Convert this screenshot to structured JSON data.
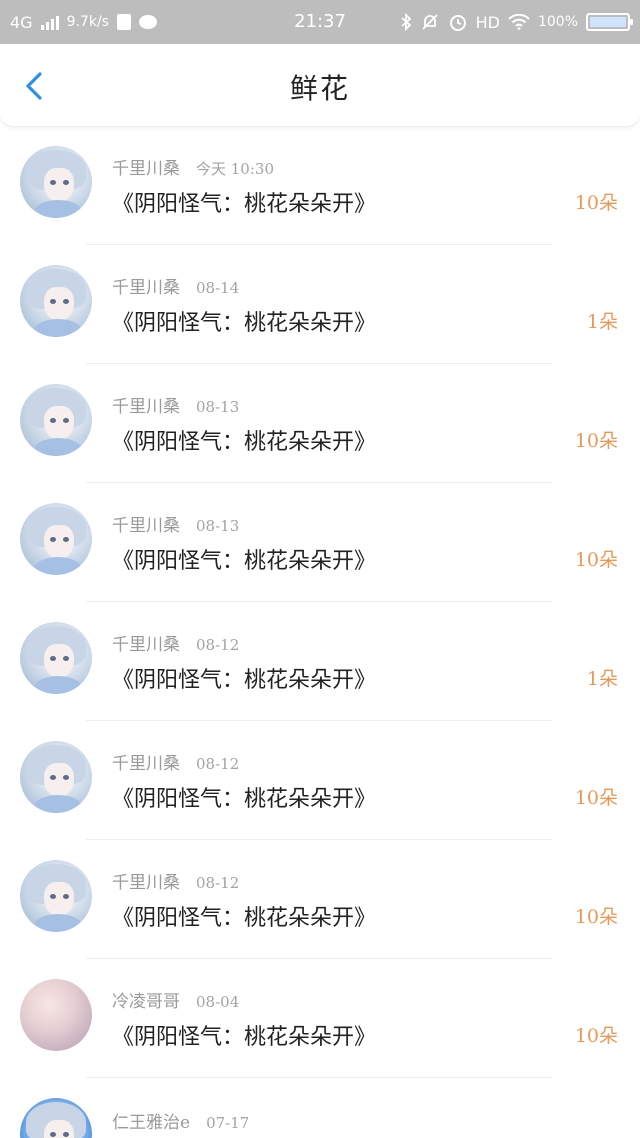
{
  "statusbar": {
    "network": "4G",
    "speed": "9.7k/s",
    "time": "21:37",
    "hd": "HD",
    "battery": "100%"
  },
  "header": {
    "title": "鲜花"
  },
  "list": [
    {
      "user": "千里川桑",
      "date": "今天 10:30",
      "work": "《阴阳怪气：桃花朵朵开》",
      "count": "10朵"
    },
    {
      "user": "千里川桑",
      "date": "08-14",
      "work": "《阴阳怪气：桃花朵朵开》",
      "count": "1朵"
    },
    {
      "user": "千里川桑",
      "date": "08-13",
      "work": "《阴阳怪气：桃花朵朵开》",
      "count": "10朵"
    },
    {
      "user": "千里川桑",
      "date": "08-13",
      "work": "《阴阳怪气：桃花朵朵开》",
      "count": "10朵"
    },
    {
      "user": "千里川桑",
      "date": "08-12",
      "work": "《阴阳怪气：桃花朵朵开》",
      "count": "1朵"
    },
    {
      "user": "千里川桑",
      "date": "08-12",
      "work": "《阴阳怪气：桃花朵朵开》",
      "count": "10朵"
    },
    {
      "user": "千里川桑",
      "date": "08-12",
      "work": "《阴阳怪气：桃花朵朵开》",
      "count": "10朵"
    },
    {
      "user": "冷凌哥哥",
      "date": "08-04",
      "work": "《阴阳怪气：桃花朵朵开》",
      "count": "10朵"
    },
    {
      "user": "仁王雅治e",
      "date": "07-17"
    }
  ],
  "colors": {
    "accent": "#2f8ee5",
    "count": "#e59a5b",
    "statusbar": "#bdbdbd"
  }
}
